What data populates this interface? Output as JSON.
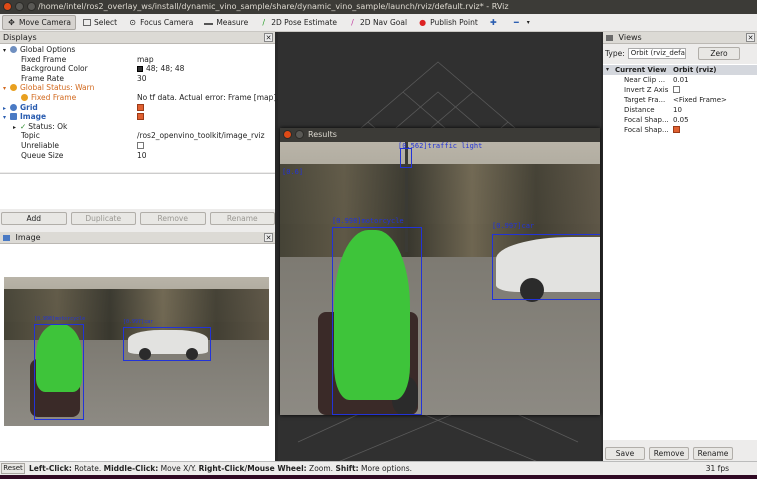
{
  "window": {
    "title": "/home/intel/ros2_overlay_ws/install/dynamic_vino_sample/share/dynamic_vino_sample/launch/rviz/default.rviz* - RViz"
  },
  "toolbar": {
    "move_camera": "Move Camera",
    "select": "Select",
    "focus_camera": "Focus Camera",
    "measure": "Measure",
    "pose_estimate": "2D Pose Estimate",
    "nav_goal": "2D Nav Goal",
    "publish_point": "Publish Point"
  },
  "displays": {
    "title": "Displays",
    "rows": [
      {
        "key": "Global Options"
      },
      {
        "key": "Fixed Frame",
        "value": "map"
      },
      {
        "key": "Background Color",
        "value": "48; 48; 48"
      },
      {
        "key": "Frame Rate",
        "value": "30"
      },
      {
        "key": "Global Status: Warn"
      },
      {
        "key": "Fixed Frame",
        "value": "No tf data.  Actual error: Frame [map]..."
      },
      {
        "key": "Grid"
      },
      {
        "key": "Image"
      },
      {
        "key": "Status: Ok"
      },
      {
        "key": "Topic",
        "value": "/ros2_openvino_toolkit/image_rviz"
      },
      {
        "key": "Unreliable"
      },
      {
        "key": "Queue Size",
        "value": "10"
      }
    ],
    "buttons": {
      "add": "Add",
      "duplicate": "Duplicate",
      "remove": "Remove",
      "rename": "Rename"
    }
  },
  "image_panel": {
    "title": "Image"
  },
  "results": {
    "title": "Results"
  },
  "views": {
    "title": "Views",
    "type_label": "Type:",
    "type_value": "Orbit (rviz_defa",
    "zero": "Zero",
    "header": {
      "key": "Current View",
      "value": "Orbit (rviz)"
    },
    "rows": [
      {
        "key": "Near Clip ...",
        "value": "0.01"
      },
      {
        "key": "Invert Z Axis",
        "value": ""
      },
      {
        "key": "Target Fra...",
        "value": "<Fixed Frame>"
      },
      {
        "key": "Distance",
        "value": "10"
      },
      {
        "key": "Focal Shap...",
        "value": "0.05"
      },
      {
        "key": "Focal Shap...",
        "value": ""
      }
    ],
    "buttons": {
      "save": "Save",
      "remove": "Remove",
      "rename": "Rename"
    }
  },
  "status": {
    "reset": "Reset",
    "msg_left_b": "Left-Click:",
    "msg_left": " Rotate. ",
    "msg_mid_b": "Middle-Click:",
    "msg_mid": " Move X/Y. ",
    "msg_right_b": "Right-Click/Mouse Wheel:",
    "msg_right": " Zoom. ",
    "msg_shift_b": "Shift:",
    "msg_shift": " More options.",
    "fps": "31 fps"
  },
  "detections": {
    "small": [
      {
        "label": "[0.998]motorcycle"
      },
      {
        "label": "[0.997]car"
      }
    ],
    "large": [
      {
        "label": "[0.998]motorcycle"
      },
      {
        "label": "[0.997]car"
      },
      {
        "label": "[0.562]traffic light"
      },
      {
        "label": "[0.6]"
      }
    ]
  },
  "colors": {
    "accent": "#2233d8",
    "mask": "#3ec43a",
    "warn": "#d2691e",
    "titlebar": "#3c3b37"
  }
}
